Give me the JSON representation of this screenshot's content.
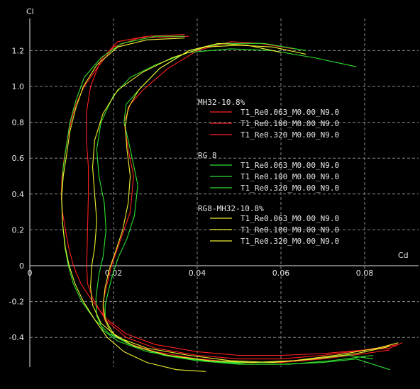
{
  "chart_data": {
    "type": "line",
    "xlabel": "Cd",
    "ylabel": "Cl",
    "xlim": [
      0,
      0.088
    ],
    "ylim": [
      -0.56,
      1.35
    ],
    "x_ticks": [
      0,
      0.02,
      0.04,
      0.06,
      0.08
    ],
    "x_tick_labels": [
      "0",
      "0.02",
      "0.04",
      "0.06",
      "0.08"
    ],
    "y_ticks": [
      -0.4,
      -0.2,
      0,
      0.2,
      0.4,
      0.6,
      0.8,
      1.0,
      1.2
    ],
    "y_tick_labels": [
      "-0.4",
      "-0.2",
      "0",
      "0.2",
      "0.4",
      "0.6",
      "0.8",
      "1.0",
      "1.2"
    ],
    "grid": true,
    "legend_placement": "center-right",
    "groups": [
      {
        "name": "MH32-10.8%",
        "color": "#ff2020",
        "series": [
          {
            "name": "T1_Re0.063_M0.00_N9.0",
            "x": [
              0.038,
              0.026,
              0.02,
              0.016,
              0.013,
              0.011,
              0.0098,
              0.009,
              0.0082,
              0.0077,
              0.0075,
              0.0078,
              0.0085,
              0.0093,
              0.0104,
              0.0122,
              0.015,
              0.0185,
              0.023,
              0.03,
              0.04,
              0.05,
              0.06,
              0.07,
              0.08,
              0.086,
              0.089
            ],
            "y": [
              1.28,
              1.27,
              1.22,
              1.1,
              1.0,
              0.9,
              0.8,
              0.7,
              0.6,
              0.5,
              0.4,
              0.3,
              0.2,
              0.1,
              0.0,
              -0.1,
              -0.2,
              -0.3,
              -0.38,
              -0.44,
              -0.48,
              -0.5,
              -0.5,
              -0.49,
              -0.47,
              -0.46,
              -0.43
            ]
          },
          {
            "name": "T1_Re0.100_M0.00_N9.0",
            "x": [
              0.037,
              0.028,
              0.021,
              0.017,
              0.0145,
              0.0135,
              0.0135,
              0.014,
              0.014,
              0.0138,
              0.0136,
              0.0138,
              0.015,
              0.018,
              0.023,
              0.03,
              0.04,
              0.05,
              0.06,
              0.07,
              0.08,
              0.088
            ],
            "y": [
              1.29,
              1.28,
              1.25,
              1.15,
              1.0,
              0.85,
              0.7,
              0.55,
              0.4,
              0.2,
              0.0,
              -0.1,
              -0.18,
              -0.3,
              -0.4,
              -0.46,
              -0.5,
              -0.52,
              -0.52,
              -0.5,
              -0.47,
              -0.44
            ]
          },
          {
            "name": "T1_Re0.320_M0.00_N9.0",
            "x": [
              0.063,
              0.055,
              0.048,
              0.04,
              0.033,
              0.027,
              0.024,
              0.0225,
              0.0235,
              0.0248,
              0.024,
              0.0225,
              0.021,
              0.0195,
              0.0185,
              0.0175,
              0.0175,
              0.019,
              0.023,
              0.03,
              0.04,
              0.05,
              0.06,
              0.07,
              0.08,
              0.086
            ],
            "y": [
              1.21,
              1.24,
              1.25,
              1.2,
              1.1,
              0.98,
              0.9,
              0.8,
              0.65,
              0.5,
              0.3,
              0.2,
              0.1,
              0.0,
              -0.1,
              -0.2,
              -0.28,
              -0.36,
              -0.43,
              -0.48,
              -0.52,
              -0.54,
              -0.54,
              -0.52,
              -0.49,
              -0.47
            ]
          }
        ]
      },
      {
        "name": "RG 8",
        "color": "#30e030",
        "series": [
          {
            "name": "T1_Re0.063_M0.00_N9.0",
            "x": [
              0.037,
              0.03,
              0.022,
              0.017,
              0.013,
              0.011,
              0.0096,
              0.0088,
              0.008,
              0.0076,
              0.0078,
              0.0084,
              0.0092,
              0.0104,
              0.0124,
              0.0155,
              0.019,
              0.024,
              0.032,
              0.04,
              0.05,
              0.06,
              0.07,
              0.078,
              0.086
            ],
            "y": [
              1.28,
              1.28,
              1.24,
              1.16,
              1.05,
              0.92,
              0.8,
              0.68,
              0.55,
              0.4,
              0.25,
              0.1,
              0.0,
              -0.1,
              -0.2,
              -0.3,
              -0.38,
              -0.44,
              -0.5,
              -0.53,
              -0.55,
              -0.55,
              -0.54,
              -0.52,
              -0.58
            ]
          },
          {
            "name": "T1_Re0.100_M0.00_N9.0",
            "x": [
              0.078,
              0.068,
              0.058,
              0.048,
              0.038,
              0.03,
              0.024,
              0.02,
              0.017,
              0.016,
              0.0165,
              0.0178,
              0.0182,
              0.0175,
              0.0165,
              0.0158,
              0.016,
              0.0175,
              0.021,
              0.028,
              0.038,
              0.048,
              0.058,
              0.068,
              0.076,
              0.082
            ],
            "y": [
              1.11,
              1.16,
              1.2,
              1.21,
              1.19,
              1.12,
              1.05,
              0.95,
              0.8,
              0.65,
              0.5,
              0.35,
              0.2,
              0.05,
              -0.05,
              -0.18,
              -0.28,
              -0.36,
              -0.42,
              -0.48,
              -0.52,
              -0.54,
              -0.54,
              -0.52,
              -0.5,
              -0.52
            ]
          },
          {
            "name": "T1_Re0.320_M0.00_N9.0",
            "x": [
              0.066,
              0.056,
              0.046,
              0.038,
              0.031,
              0.026,
              0.023,
              0.0225,
              0.024,
              0.0258,
              0.025,
              0.0232,
              0.0212,
              0.0198,
              0.0188,
              0.018,
              0.018,
              0.0195,
              0.024,
              0.032,
              0.042,
              0.052,
              0.062,
              0.072,
              0.082
            ],
            "y": [
              1.2,
              1.24,
              1.24,
              1.2,
              1.1,
              0.98,
              0.9,
              0.8,
              0.65,
              0.45,
              0.28,
              0.15,
              0.05,
              -0.05,
              -0.14,
              -0.22,
              -0.3,
              -0.38,
              -0.44,
              -0.5,
              -0.53,
              -0.55,
              -0.55,
              -0.53,
              -0.5
            ]
          }
        ]
      },
      {
        "name": "RG8-MH32-10.8%",
        "color": "#f0f030",
        "series": [
          {
            "name": "T1_Re0.063_M0.00_N9.0",
            "x": [
              0.037,
              0.028,
              0.021,
              0.016,
              0.0128,
              0.011,
              0.0096,
              0.0088,
              0.008,
              0.0076,
              0.0078,
              0.0085,
              0.0094,
              0.0108,
              0.0128,
              0.0155,
              0.0185,
              0.0225,
              0.028,
              0.035,
              0.042
            ],
            "y": [
              1.27,
              1.26,
              1.22,
              1.12,
              1.0,
              0.88,
              0.75,
              0.62,
              0.5,
              0.38,
              0.24,
              0.1,
              0.0,
              -0.1,
              -0.2,
              -0.3,
              -0.4,
              -0.48,
              -0.54,
              -0.58,
              -0.59
            ]
          },
          {
            "name": "T1_Re0.100_M0.00_N9.0",
            "x": [
              0.066,
              0.058,
              0.05,
              0.042,
              0.034,
              0.027,
              0.021,
              0.0175,
              0.0155,
              0.015,
              0.0155,
              0.016,
              0.0155,
              0.0148,
              0.0145,
              0.015,
              0.017,
              0.021,
              0.028,
              0.038,
              0.048,
              0.058,
              0.068,
              0.078,
              0.086
            ],
            "y": [
              1.18,
              1.22,
              1.23,
              1.22,
              1.16,
              1.08,
              0.98,
              0.85,
              0.7,
              0.55,
              0.4,
              0.25,
              0.1,
              0.0,
              -0.12,
              -0.22,
              -0.32,
              -0.4,
              -0.46,
              -0.5,
              -0.53,
              -0.54,
              -0.52,
              -0.49,
              -0.45
            ]
          },
          {
            "name": "T1_Re0.320_M0.00_N9.0",
            "x": [
              0.06,
              0.052,
              0.045,
              0.038,
              0.031,
              0.026,
              0.0235,
              0.0228,
              0.0232,
              0.024,
              0.0235,
              0.0222,
              0.0205,
              0.019,
              0.018,
              0.0175,
              0.018,
              0.02,
              0.025,
              0.033,
              0.043,
              0.053,
              0.063,
              0.073,
              0.083,
              0.088
            ],
            "y": [
              1.19,
              1.23,
              1.24,
              1.2,
              1.1,
              0.98,
              0.88,
              0.78,
              0.65,
              0.5,
              0.35,
              0.2,
              0.08,
              -0.02,
              -0.12,
              -0.22,
              -0.3,
              -0.38,
              -0.45,
              -0.5,
              -0.53,
              -0.54,
              -0.53,
              -0.5,
              -0.46,
              -0.43
            ]
          }
        ]
      }
    ]
  }
}
